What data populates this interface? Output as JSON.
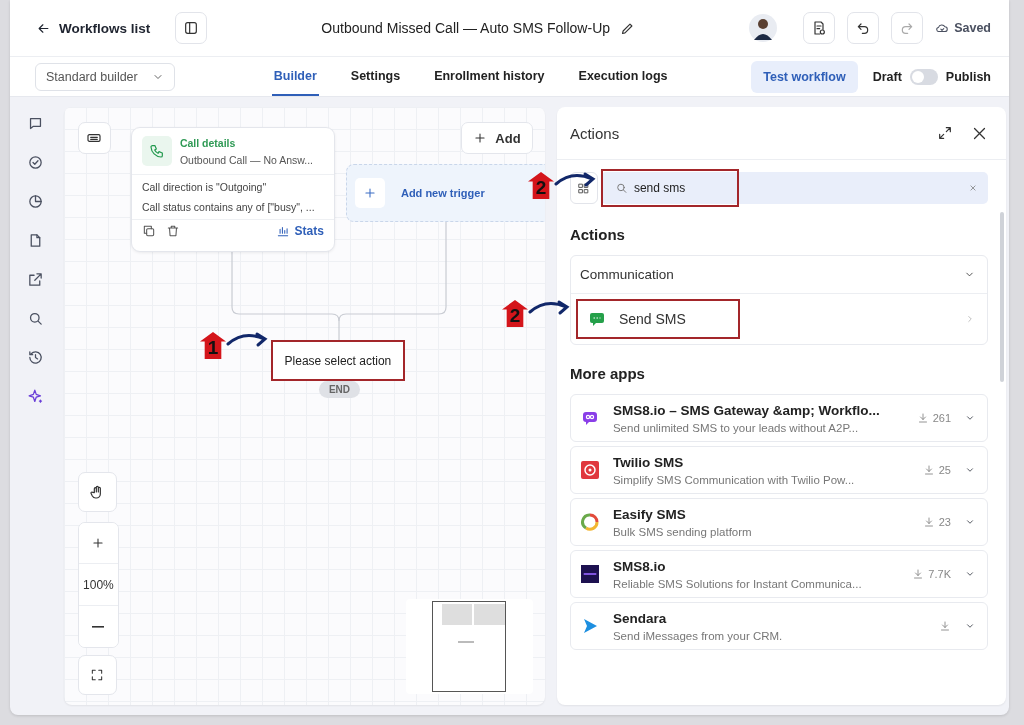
{
  "header": {
    "back_link": "Workflows list",
    "title": "Outbound Missed Call — Auto SMS Follow-Up",
    "status": "Saved"
  },
  "toolbar": {
    "builder_select": "Standard builder",
    "tabs": [
      {
        "label": "Builder",
        "selected": true
      },
      {
        "label": "Settings",
        "selected": false
      },
      {
        "label": "Enrollment history",
        "selected": false
      },
      {
        "label": "Execution logs",
        "selected": false
      }
    ],
    "test_button": "Test workflow",
    "draft_label": "Draft",
    "publish_toggle": {
      "on": false
    },
    "publish_label": "Publish"
  },
  "canvas": {
    "trigger_node": {
      "title": "Call details",
      "subtitle": "Outbound Call — No Answ...",
      "conditions": [
        "Call direction is \"Outgoing\"",
        "Call status contains any of [\"busy\", ..."
      ],
      "stats": "Stats"
    },
    "add_button": "Add",
    "add_trigger": "Add new trigger",
    "action_node": {
      "label": "Please select action",
      "highlighted": true
    },
    "end_label": "END",
    "zoom": "100%"
  },
  "annotations": [
    {
      "number": "1"
    },
    {
      "number": "2"
    },
    {
      "number": "2"
    }
  ],
  "panel": {
    "title": "Actions",
    "search": {
      "value": "send sms",
      "highlighted": true
    },
    "actions_heading": "Actions",
    "category": {
      "label": "Communication",
      "expanded": true,
      "items": [
        {
          "label": "Send SMS",
          "highlighted": true
        }
      ]
    },
    "more_apps_heading": "More apps",
    "apps": [
      {
        "name": "SMS8.io – SMS Gateway &amp; Workflo...",
        "description": "Send unlimited SMS to your leads without A2P...",
        "downloads": "261"
      },
      {
        "name": "Twilio SMS",
        "description": "Simplify SMS Communication with Twilio Pow...",
        "downloads": "25"
      },
      {
        "name": "Easify SMS",
        "description": "Bulk SMS sending platform",
        "downloads": "23"
      },
      {
        "name": "SMS8.io",
        "description": "Reliable SMS Solutions for Instant Communica...",
        "downloads": "7.7K"
      },
      {
        "name": "Sendara",
        "description": "Send iMessages from your CRM."
      }
    ]
  }
}
